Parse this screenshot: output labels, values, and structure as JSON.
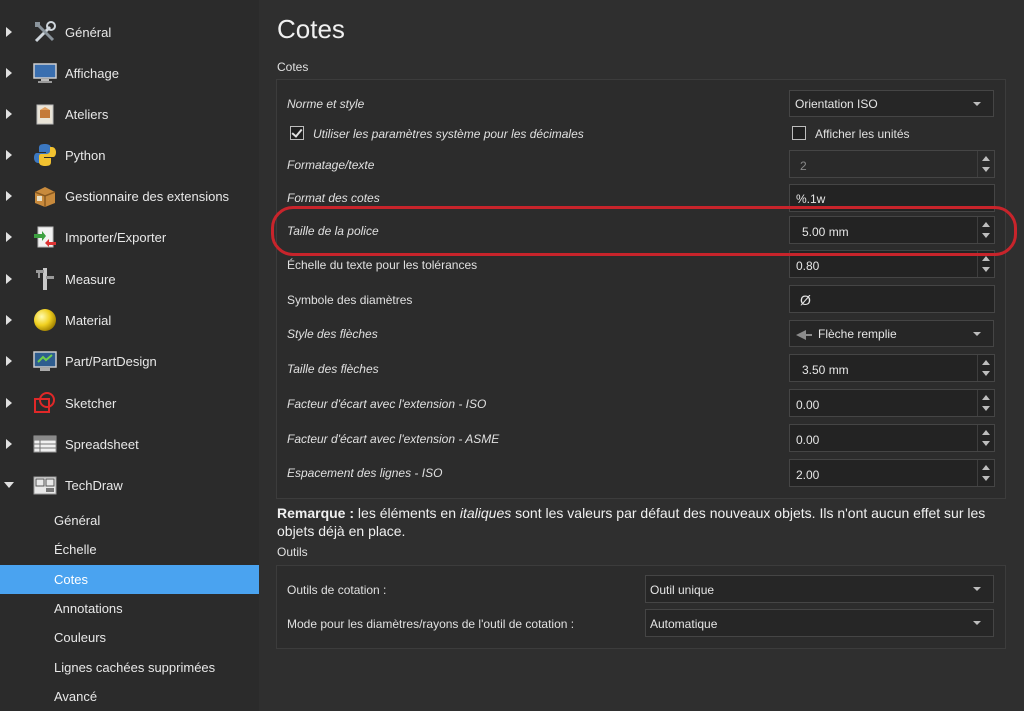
{
  "sidebar": {
    "items": [
      {
        "label": "Général",
        "icon": "tools-icon"
      },
      {
        "label": "Affichage",
        "icon": "monitor-icon"
      },
      {
        "label": "Ateliers",
        "icon": "workbench-icon"
      },
      {
        "label": "Python",
        "icon": "python-icon"
      },
      {
        "label": "Gestionnaire des extensions",
        "icon": "addon-manager-icon"
      },
      {
        "label": "Importer/Exporter",
        "icon": "import-export-icon"
      },
      {
        "label": "Measure",
        "icon": "caliper-icon"
      },
      {
        "label": "Material",
        "icon": "material-sphere-icon"
      },
      {
        "label": "Part/PartDesign",
        "icon": "part-design-icon"
      },
      {
        "label": "Sketcher",
        "icon": "sketcher-icon"
      },
      {
        "label": "Spreadsheet",
        "icon": "spreadsheet-icon"
      },
      {
        "label": "TechDraw",
        "icon": "techdraw-icon"
      }
    ],
    "subitems": [
      "Général",
      "Échelle",
      "Cotes",
      "Annotations",
      "Couleurs",
      "Lignes cachées supprimées",
      "Avancé"
    ],
    "selected_subitem": "Cotes"
  },
  "main": {
    "title": "Cotes",
    "cotes_group": {
      "title": "Cotes",
      "norme_label": "Norme et style",
      "norme_value": "Orientation ISO",
      "use_system_decimals_label": "Utiliser les paramètres système pour les décimales",
      "use_system_decimals_checked": true,
      "show_units_label": "Afficher les unités",
      "show_units_checked": false,
      "formatage_label": "Formatage/texte",
      "formatage_value": "2",
      "format_cotes_label": "Format des cotes",
      "format_cotes_value": "%.1w",
      "taille_police_label": "Taille de la police",
      "taille_police_value": "5.00 mm",
      "echelle_texte_label": "Échelle du texte pour les tolérances",
      "echelle_texte_value": "0.80",
      "symbole_diam_label": "Symbole des diamètres",
      "symbole_diam_value": "Ø",
      "style_fleches_label": "Style des flèches",
      "style_fleches_value": "Flèche remplie",
      "taille_fleches_label": "Taille des flèches",
      "taille_fleches_value": "3.50 mm",
      "ecart_iso_label": "Facteur d'écart avec l'extension - ISO",
      "ecart_iso_value": "0.00",
      "ecart_asme_label": "Facteur d'écart avec l'extension - ASME",
      "ecart_asme_value": "0.00",
      "espacement_label": "Espacement des lignes - ISO",
      "espacement_value": "2.00"
    },
    "remark": {
      "bold": "Remarque :",
      "part1": " les éléments en ",
      "italic": "italiques",
      "part2": " sont les valeurs par défaut des nouveaux objets. Ils n'ont aucun effet sur les objets déjà en place."
    },
    "outils_group": {
      "title": "Outils",
      "outils_cotation_label": "Outils de cotation :",
      "outils_cotation_value": "Outil unique",
      "mode_diam_label": "Mode pour les diamètres/rayons de l'outil de cotation :",
      "mode_diam_value": "Automatique"
    }
  },
  "colors": {
    "selection": "#4aa3f0",
    "highlight_annotation": "#c8242b"
  }
}
